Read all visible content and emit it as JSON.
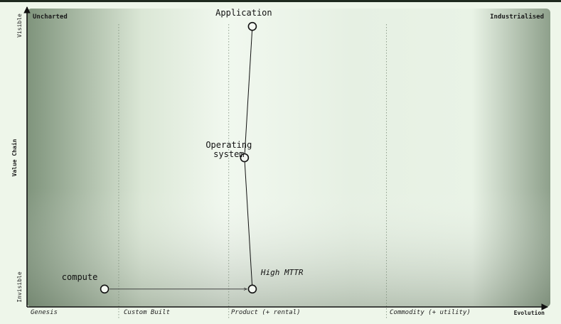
{
  "map": {
    "corner_left": "Uncharted",
    "corner_right": "Industrialised",
    "y_axis": {
      "title": "Value Chain",
      "top_label": "Visible",
      "bottom_label": "Invisible"
    },
    "x_axis": {
      "title": "Evolution",
      "stages": [
        "Genesis",
        "Custom Built",
        "Product (+ rental)",
        "Commodity (+ utility)"
      ]
    },
    "components": [
      {
        "id": "application",
        "label_lines": [
          "Application"
        ],
        "evolution": 0.43,
        "visibility": 0.94
      },
      {
        "id": "operating-system",
        "label_lines": [
          "Operating",
          "system"
        ],
        "evolution": 0.415,
        "visibility": 0.5
      },
      {
        "id": "compute-product",
        "label_lines": [],
        "evolution": 0.43,
        "visibility": 0.06
      },
      {
        "id": "compute",
        "label_lines": [
          "compute"
        ],
        "evolution": 0.148,
        "visibility": 0.06
      }
    ],
    "links": [
      {
        "from": "application",
        "to": "operating-system"
      },
      {
        "from": "operating-system",
        "to": "compute-product"
      }
    ],
    "evolution_arrows": [
      {
        "from": "compute",
        "to": "compute-product"
      }
    ],
    "annotations": [
      {
        "text": "High MTTR",
        "near": "compute-product"
      }
    ],
    "colors": {
      "background_light": "#eef6ea",
      "vignette_dark": "#8d9f8a",
      "axis": "#111111",
      "node_fill": "#f4f8f2",
      "node_stroke": "#111111"
    }
  }
}
